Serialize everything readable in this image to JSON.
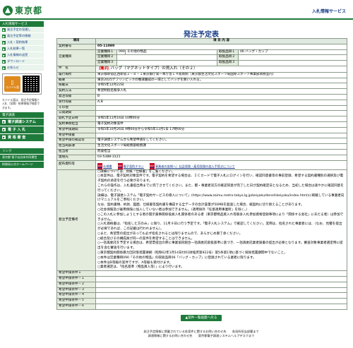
{
  "header": {
    "logo_text": "東京都",
    "site_title": "入札情報サービス"
  },
  "sidebar": {
    "menu_head": "入札情報サービス",
    "menu_items": [
      "発注予定の見通し",
      "発注予定等の情報",
      "入札・契約結果",
      "入札結果一覧",
      "入札情報の送受",
      "ダウンロード",
      "お知らせ"
    ],
    "mobile_label": "モバイル版",
    "mobile_note": "モバイル版は、発注予定情報と入札（見積）結果情報が検索できます。",
    "system_head": "電子調達",
    "system_items": [
      "電子調達システム",
      "電 子 入 札",
      "資 格 審 査"
    ],
    "links_head": "リンク",
    "links": [
      "東京都 電子自治体共同運営",
      "財務局公式ホームページ"
    ]
  },
  "main": {
    "title": "発注予定表",
    "col_headers": [
      "項目",
      "項 目 内 容"
    ],
    "rows": {
      "contract_no_label": "契約番号",
      "contract_no": "05-11080",
      "business_class_label": "営業種目",
      "business_classes": [
        {
          "label": "営業種目１",
          "code": "090",
          "name": "その他の物品",
          "item_label": "取扱品目１",
          "item": "06 バッグ・カップ"
        },
        {
          "label": "営業種目２",
          "code": "",
          "name": "",
          "item_label": "取扱品目２",
          "item": ""
        },
        {
          "label": "営業種目３",
          "code": "",
          "name": "",
          "item_label": "取扱品目３",
          "item": ""
        }
      ],
      "name_label": "件　名",
      "name_tag": "【電子】",
      "name": "バッグ（マグネットタイプ）の買入れ（その２）",
      "place_label": "履行場所",
      "place": "東京都新宿区西新宿２－８－１東京都庁第一本庁舎１４階南側（東京都生活文化スポーツ局国際スポーツ事業部執務室内）",
      "summary_label": "概要",
      "summary": "東京2025デフリンピックの機運醸成の一環としてバッグを買い入れる。",
      "date_label": "掲載日",
      "date": "令和5年12月22日",
      "method_label": "契約方法",
      "method": "希望制指名競争入札",
      "rank_label": "発注等級",
      "rank": "B",
      "accept_label": "受付等級",
      "accept": "A,B",
      "other_label": "その他",
      "public_period_label": "公開期間",
      "public_period": "",
      "open_label": "開札予定日時",
      "open": "令和5年11月16日 10時00分",
      "dept_label": "契約事務担当",
      "dept": "電子契約対象案件",
      "period_label": "希望申請期間",
      "period": "令和5年10月26日 9時00分から令和5年11月1日 17時00分",
      "doc_label": "希望申請書",
      "doc": "",
      "recv_label": "希望申請の確認等",
      "recv": "電子調達システムから希望申請をしてください。",
      "office_label": "担当局部課",
      "office": "生活文化スポーツ局総務部総務課",
      "person_label": "担当者",
      "person": "而座担当",
      "phone_label": "連絡先",
      "phone": "03-5388-3121",
      "attach_label": "配布資料等",
      "attachments": [
        "仕様書",
        "電子契約チラシ",
        "事業者の皆様へ）社会保険・雇用保険の加入手続きについて"
      ],
      "notes_label": "発注予定備考",
      "notes": [
        "○詳細については、別紙「仕様書」をご覧ください。",
        "○本案件は、電子契約対象案件です。電子契約を希望する場合は、ＩＣカードで電子入札にログインを行い、確認同意書等の事前登録、希望する契約書種別の選択及び電子契約の承諾を行う必要があります。",
        "これらの操作は、入札書提出時までに完了させてください。また、都・事業者双方の確認同意が完了した日が契約確定日となるため、当初した場合は速やかに確認同意を行ってください。",
        "詳細は、電子調達システム「電子契約サービスの導入について」(https://www.zaimu.metro.tokyo.lg.jp/keiyaku/denshikeiyaku/index.html)に掲載している事業者向けマニュアルをご参照ください。",
        "なお、契約書類、約款、図面、仕様書等契約書を構成する全データの合計容量が50MBを超過した場合、紙契約に切り替えることがあります。",
        "○社会保険及び雇用保険に加入していない者は参加できません。（適用除外「任意適用事業所」を除く。）",
        "○この入札に参加しようとする者の開示薬事関係役員入札関係者のある者（東京都物品買入れ等競争入札参加資格登録事項により「関係する会社」にあたる者）は参加できません。",
        "○入札価格書は、「指名した方のみ」に限り、11月９日に行う予定です。「電子入札システム」で確認してください。実際は、指名された事業者には、（なお、見積を提出が必要であれば、この記載は行われません）。",
        "○また、希望票の提出があっても必ず指名されるとは限りませんので、あらかじめ御了承ください。",
        "○総合及びその構成員が同一の案件を希望することはできません。",
        "○一括再委託を予定する場合は、希望票提出の際に事業協同組合一括再委託取扱基準に基づき、一括再委託業者調書の提出が必要となります。審査対象事業者選定時に提出を含む審査を行います。",
        "○東京都契約関係暴力団対策措置要綱（昭和62年1月14日付61財経庶第922号）第5条第1項に基づく排除措置期間中でないこと。",
        "○本件は営業種目090「その他の物品」の取扱品目06「バッグ・カップ」に登録されている業者に限ります。",
        "○本件はB等級の案件ですが、A等級も受付けます。",
        "○業者選定は、「指名基準（物品買入等）」により行います。"
      ],
      "extra_labels": [
        "希望申請条件１",
        "希望申請条件－１",
        "希望申請条件－２",
        "希望申請条件－３",
        "希望申請条件－４",
        "希望申請条件－５",
        "希望申請条件－６"
      ]
    },
    "back_button": "▲案件一覧画面へ戻る"
  },
  "footer": {
    "line1": "発注予定情報に掲載されている各案件に関するお問い合わせ先　　各局所担当部署まで",
    "line2": "調達情報に関するお問い合わせ先　　東京都電子調達システムヘルプデスクまで"
  },
  "colors": {
    "brand_green": "#1e7a3a",
    "link_blue": "#1a3f8a",
    "header_cell": "#dfe9df",
    "label_cell": "#e4ecde",
    "pdf_red": "#c8102e",
    "mobile_orange": "#e08a1e"
  }
}
